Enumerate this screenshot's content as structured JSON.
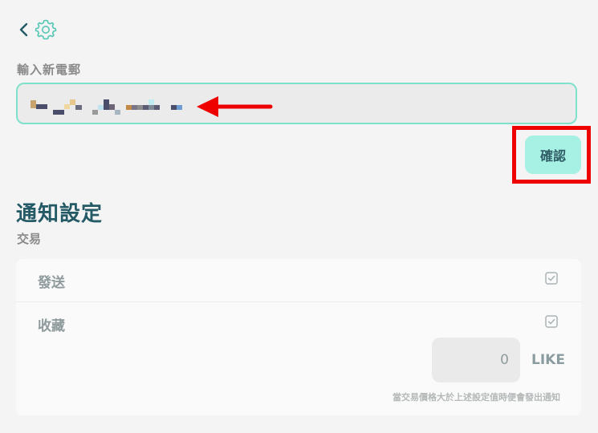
{
  "nav": {
    "back_icon": "chevron-left-icon",
    "settings_icon": "gear-icon"
  },
  "email": {
    "label": "輸入新電郵",
    "value_state": "pixelated"
  },
  "confirm_button": {
    "label": "確認"
  },
  "notifications": {
    "title": "通知設定",
    "category": "交易",
    "rows": [
      {
        "label": "發送",
        "checked": true
      },
      {
        "label": "收藏",
        "checked": true
      }
    ],
    "threshold_value": "0",
    "threshold_unit": "LIKE",
    "hint": "當交易價格大於上述設定值時便會發出通知"
  },
  "colors": {
    "accent_border": "#7fe0cb",
    "confirm_bg": "#a6f0e4",
    "title": "#245a66",
    "highlight": "#ee0000"
  }
}
